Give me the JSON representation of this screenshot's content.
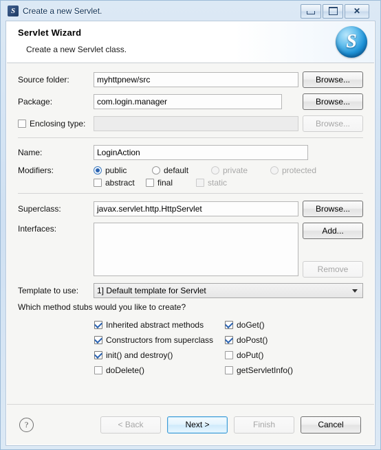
{
  "window": {
    "title": "Create a new Servlet.",
    "app_icon": "servlet-s-icon",
    "controls": {
      "minimize": "minimize-icon",
      "maximize": "maximize-icon",
      "close": "close-icon"
    }
  },
  "header": {
    "title": "Servlet Wizard",
    "subtitle": "Create a new Servlet class.",
    "badge_letter": "S"
  },
  "form": {
    "source_folder": {
      "label": "Source folder:",
      "value": "myhttpnew/src",
      "button": "Browse..."
    },
    "package": {
      "label": "Package:",
      "value": "com.login.manager",
      "button": "Browse..."
    },
    "enclosing_type": {
      "label": "Enclosing type:",
      "value": "",
      "button": "Browse...",
      "checked": false
    },
    "name": {
      "label": "Name:",
      "value": "LoginAction"
    },
    "modifiers": {
      "label": "Modifiers:",
      "access": [
        {
          "label": "public",
          "selected": true,
          "disabled": false
        },
        {
          "label": "default",
          "selected": false,
          "disabled": false
        },
        {
          "label": "private",
          "selected": false,
          "disabled": true
        },
        {
          "label": "protected",
          "selected": false,
          "disabled": true
        }
      ],
      "flags": [
        {
          "label": "abstract",
          "checked": false,
          "disabled": false
        },
        {
          "label": "final",
          "checked": false,
          "disabled": false
        },
        {
          "label": "static",
          "checked": false,
          "disabled": true
        }
      ]
    },
    "superclass": {
      "label": "Superclass:",
      "value": "javax.servlet.http.HttpServlet",
      "button": "Browse..."
    },
    "interfaces": {
      "label": "Interfaces:",
      "items": [],
      "add_button": "Add...",
      "remove_button": "Remove"
    },
    "template": {
      "label": "Template to use:",
      "value": "1] Default template for Servlet"
    }
  },
  "stubs": {
    "question": "Which method stubs would you like to create?",
    "left": [
      {
        "label": "Inherited abstract methods",
        "checked": true
      },
      {
        "label": "Constructors from superclass",
        "checked": true
      },
      {
        "label": "init() and destroy()",
        "checked": true
      },
      {
        "label": "doDelete()",
        "checked": false
      }
    ],
    "right": [
      {
        "label": "doGet()",
        "checked": true
      },
      {
        "label": "doPost()",
        "checked": true
      },
      {
        "label": "doPut()",
        "checked": false
      },
      {
        "label": "getServletInfo()",
        "checked": false
      }
    ]
  },
  "footer": {
    "help_icon": "?",
    "buttons": [
      {
        "label": "< Back",
        "disabled": true,
        "default": false
      },
      {
        "label": "Next >",
        "disabled": false,
        "default": true
      },
      {
        "label": "Finish",
        "disabled": true,
        "default": false
      },
      {
        "label": "Cancel",
        "disabled": false,
        "default": false
      }
    ]
  },
  "colors": {
    "accent": "#3c9ad6",
    "frame": "#cfe0f2",
    "client": "#f6f6f4"
  }
}
